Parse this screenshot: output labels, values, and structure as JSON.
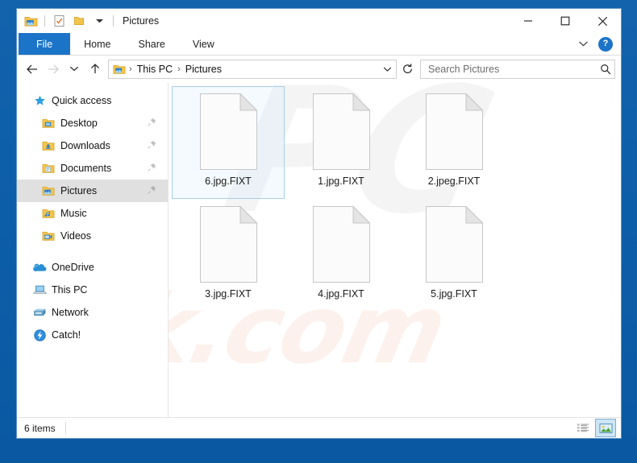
{
  "window": {
    "title": "Pictures",
    "quick_access_toolbar": [
      {
        "name": "pictures-folder-icon",
        "tooltip": "Pictures"
      },
      {
        "name": "properties-icon",
        "tooltip": "Properties"
      },
      {
        "name": "new-folder-icon",
        "tooltip": "New folder"
      },
      {
        "name": "chevron-down-icon",
        "tooltip": "Customize Quick Access Toolbar"
      }
    ],
    "controls": {
      "minimize": "—",
      "maximize": "□",
      "close": "✕"
    }
  },
  "ribbon": {
    "tabs": [
      {
        "label": "File",
        "active": true
      },
      {
        "label": "Home",
        "active": false
      },
      {
        "label": "Share",
        "active": false
      },
      {
        "label": "View",
        "active": false
      }
    ],
    "expand_icon": "chevron-down-icon",
    "help_label": "?"
  },
  "navigation": {
    "back": "←",
    "forward": "→",
    "recent_locations": "⌄",
    "up": "↑",
    "refresh": "↻",
    "breadcrumb": {
      "icon": "pictures-folder-icon",
      "segments": [
        "This PC",
        "Pictures"
      ],
      "separator": "›"
    },
    "search": {
      "placeholder": "Search Pictures",
      "value": "",
      "icon": "search-icon"
    }
  },
  "sidebar": {
    "items": [
      {
        "label": "Quick access",
        "icon": "star-icon",
        "level": "root",
        "pinned": false,
        "selected": false
      },
      {
        "label": "Desktop",
        "icon": "desktop-folder-icon",
        "level": "child",
        "pinned": true,
        "selected": false
      },
      {
        "label": "Downloads",
        "icon": "downloads-folder-icon",
        "level": "child",
        "pinned": true,
        "selected": false
      },
      {
        "label": "Documents",
        "icon": "documents-folder-icon",
        "level": "child",
        "pinned": true,
        "selected": false
      },
      {
        "label": "Pictures",
        "icon": "pictures-folder-icon",
        "level": "child",
        "pinned": true,
        "selected": true
      },
      {
        "label": "Music",
        "icon": "music-folder-icon",
        "level": "child",
        "pinned": false,
        "selected": false
      },
      {
        "label": "Videos",
        "icon": "videos-folder-icon",
        "level": "child",
        "pinned": false,
        "selected": false
      },
      {
        "label": "OneDrive",
        "icon": "onedrive-cloud-icon",
        "level": "root",
        "pinned": false,
        "selected": false
      },
      {
        "label": "This PC",
        "icon": "this-pc-icon",
        "level": "root",
        "pinned": false,
        "selected": false
      },
      {
        "label": "Network",
        "icon": "network-icon",
        "level": "root",
        "pinned": false,
        "selected": false
      },
      {
        "label": "Catch!",
        "icon": "catch-lightning-icon",
        "level": "root",
        "pinned": false,
        "selected": false
      }
    ]
  },
  "files": [
    {
      "name": "6.jpg.FIXT",
      "selected": true
    },
    {
      "name": "1.jpg.FIXT",
      "selected": false
    },
    {
      "name": "2.jpeg.FIXT",
      "selected": false
    },
    {
      "name": "3.jpg.FIXT",
      "selected": false
    },
    {
      "name": "4.jpg.FIXT",
      "selected": false
    },
    {
      "name": "5.jpg.FIXT",
      "selected": false
    }
  ],
  "watermark": {
    "top": "PC",
    "bottom": "risk.com"
  },
  "statusbar": {
    "item_count": "6 items",
    "views": [
      {
        "name": "details-view-button",
        "active": false
      },
      {
        "name": "large-icons-view-button",
        "active": true
      }
    ]
  },
  "colors": {
    "accent": "#1b74c8",
    "desktop": "#0d5ea9",
    "selection": "#aacfe8",
    "sidebar_selected": "#e0e0e0"
  }
}
